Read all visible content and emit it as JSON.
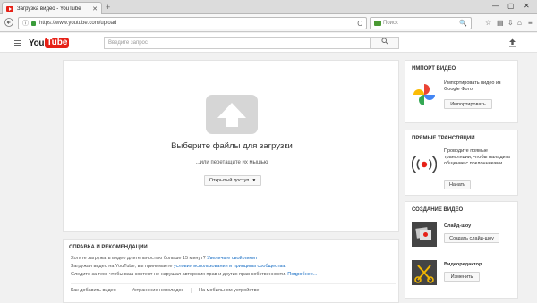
{
  "browser": {
    "tab_title": "Загрузка видео - YouTube",
    "tab_close": "✕",
    "new_tab": "+",
    "url_info": "ⓘ",
    "url": "https://www.youtube.com/upload",
    "reload": "C",
    "search_placeholder": "Поиск",
    "search_icon": "🔍",
    "window_controls": [
      "—",
      "▢",
      "✕"
    ],
    "toolbar_icons": [
      "star-icon",
      "reading-list-icon",
      "download-icon",
      "home-icon",
      "menu-icon"
    ]
  },
  "youtube": {
    "logo_you": "You",
    "logo_tube": "Tube",
    "search_placeholder": "Введите запрос",
    "search_button_icon": "🔍",
    "brand_color": "#e62117"
  },
  "upload": {
    "title": "Выберите файлы для загрузки",
    "subtitle": "...или перетащите их мышью",
    "privacy_label": "Открытый доступ",
    "privacy_caret": "▼"
  },
  "help": {
    "title": "СПРАВКА И РЕКОМЕНДАЦИИ",
    "line1_text": "Хотите загружать видео длительностью больше 15 минут?",
    "line1_link": "Увеличьте свой лимит",
    "line2_text": "Загружая видео на YouTube, вы принимаете",
    "line2_link": "условия использования и принципы сообщества.",
    "line3_text": "Следите за тем, чтобы ваш контент не нарушал авторских прав и других прав собственности.",
    "line3_link": "Подробнее...",
    "links": [
      "Как добавить видео",
      "Устранение неполадок",
      "На мобильном устройстве"
    ]
  },
  "import": {
    "title": "ИМПОРТ ВИДЕО",
    "text": "Импортировать видео из Google Фото",
    "button": "Импортировать"
  },
  "live": {
    "title": "ПРЯМЫЕ ТРАНСЛЯЦИИ",
    "text": "Проводите прямые трансляции, чтобы наладить общение с поклонниками",
    "button": "Начать"
  },
  "create": {
    "title": "СОЗДАНИЕ ВИДЕО",
    "slideshow_label": "Слайд-шоу",
    "slideshow_button": "Создать слайд-шоу",
    "editor_label": "Видеоредактор",
    "editor_button": "Изменить"
  }
}
